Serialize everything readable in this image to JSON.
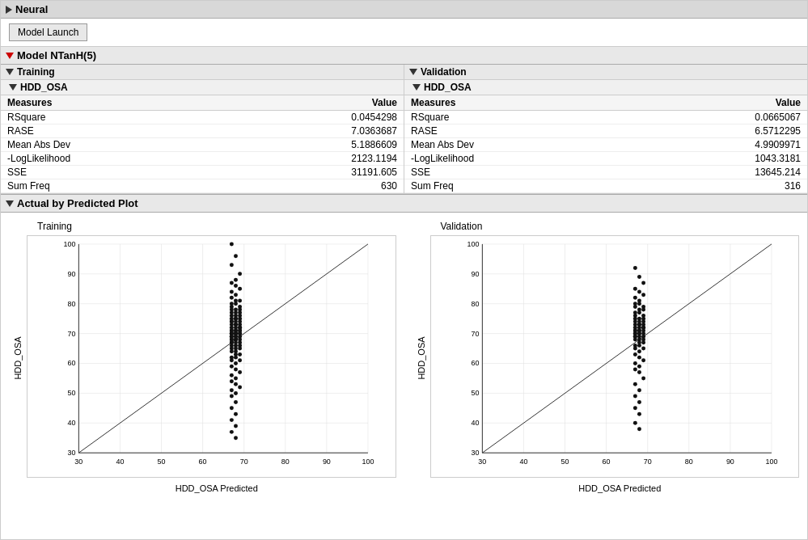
{
  "app": {
    "title": "Neural"
  },
  "model_launch": {
    "label": "Model Launch"
  },
  "model": {
    "title": "Model NTanH(5)"
  },
  "training": {
    "section_label": "Training",
    "sub_section": "HDD_OSA",
    "col_measures": "Measures",
    "col_value": "Value",
    "rows": [
      {
        "measure": "RSquare",
        "value": "0.0454298"
      },
      {
        "measure": "RASE",
        "value": "7.0363687"
      },
      {
        "measure": "Mean Abs Dev",
        "value": "5.1886609"
      },
      {
        "measure": "-LogLikelihood",
        "value": "2123.1194"
      },
      {
        "measure": "SSE",
        "value": "31191.605"
      },
      {
        "measure": "Sum Freq",
        "value": "630"
      }
    ]
  },
  "validation": {
    "section_label": "Validation",
    "sub_section": "HDD_OSA",
    "col_measures": "Measures",
    "col_value": "Value",
    "rows": [
      {
        "measure": "RSquare",
        "value": "0.0665067"
      },
      {
        "measure": "RASE",
        "value": "6.5712295"
      },
      {
        "measure": "Mean Abs Dev",
        "value": "4.9909971"
      },
      {
        "measure": "-LogLikelihood",
        "value": "1043.3181"
      },
      {
        "measure": "SSE",
        "value": "13645.214"
      },
      {
        "measure": "Sum Freq",
        "value": "316"
      }
    ]
  },
  "plot_section": {
    "title": "Actual by Predicted Plot",
    "training_label": "Training",
    "validation_label": "Validation",
    "y_axis_label": "HDD_OSA",
    "x_axis_label": "HDD_OSA Predicted",
    "axis_min": 30,
    "axis_max": 100,
    "axis_ticks": [
      30,
      40,
      50,
      60,
      70,
      80,
      90,
      100
    ]
  }
}
